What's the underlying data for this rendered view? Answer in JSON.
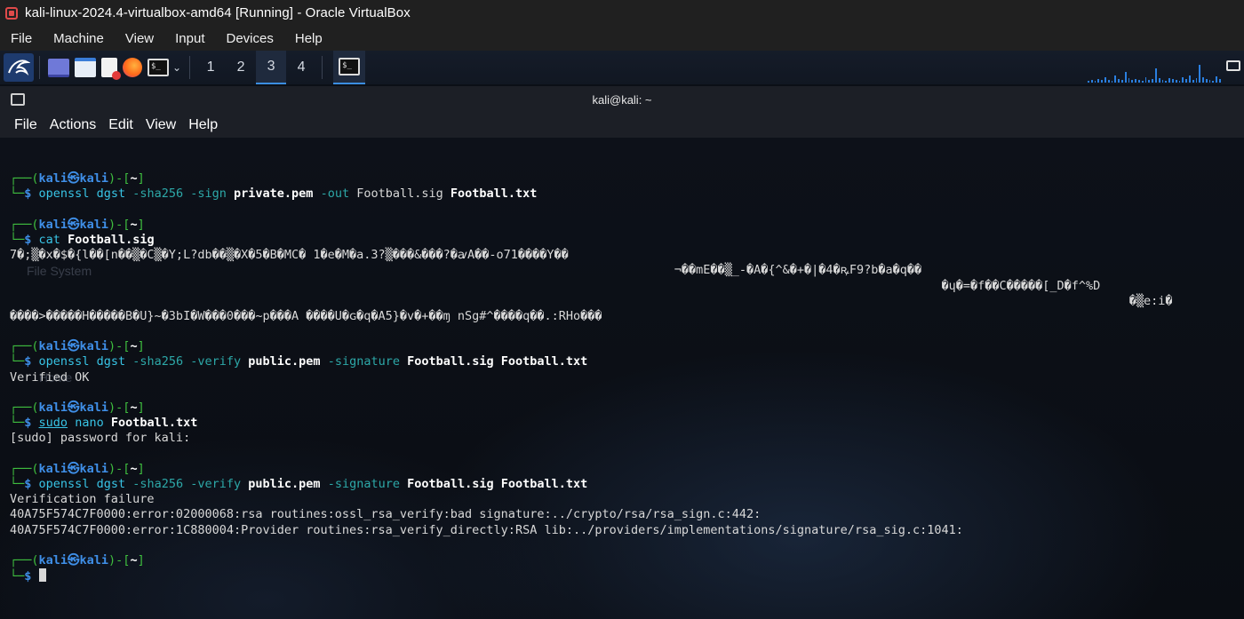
{
  "vbox": {
    "title": "kali-linux-2024.4-virtualbox-amd64 [Running] - Oracle VirtualBox",
    "menu": [
      "File",
      "Machine",
      "View",
      "Input",
      "Devices",
      "Help"
    ]
  },
  "panel": {
    "workspaces": [
      "1",
      "2",
      "3",
      "4"
    ],
    "active_workspace": "3",
    "terminal_icon_glyph": "$_"
  },
  "terminal": {
    "title": "kali@kali: ~",
    "menu": [
      "File",
      "Actions",
      "Edit",
      "View",
      "Help"
    ],
    "prompt": {
      "line1_prefix": "┌──(",
      "user": "kali",
      "at": "㉿",
      "host": "kali",
      "mid": ")-[",
      "dir": "~",
      "end": "]",
      "line2_prefix": "└─",
      "dollar": "$"
    },
    "sessions": [
      {
        "cmd": "openssl",
        "parts": [
          {
            "t": " dgst ",
            "c": "plain-cmd"
          },
          {
            "t": "-sha256 -sign ",
            "c": "opt"
          },
          {
            "t": "private.pem",
            "c": "w"
          },
          {
            "t": " -out ",
            "c": "opt"
          },
          {
            "t": "Football.sig ",
            "c": "plain"
          },
          {
            "t": "Football.txt",
            "c": "w"
          }
        ],
        "output": []
      },
      {
        "cmd": "cat",
        "parts": [
          {
            "t": " ",
            "c": "plain"
          },
          {
            "t": "Football.sig",
            "c": "w"
          }
        ],
        "output": [
          "7�;▒�x�$�{l��[n��▒�C▒�Y;L?db��▒�X�5�B�MC� 1�e�M�a.3?▒���&���?�ꜹA��-o71����Y��",
          "                                                                                            ¬��mE��▒_-�A�{^&�+�|�4�ꝶF9?b�a�q��",
          "                                                                                                                                 �ɥ�=�f��C�����[_D�f^%D",
          "                                                                                                                                                           �▒e:i�",
          "����>�����H�����B�U}~�3bI�W���0���~p���A ����U�ɢ�q�A5}�v�+��ɱ nSg#^����q��.:RHo���"
        ]
      },
      {
        "cmd": "openssl",
        "parts": [
          {
            "t": " dgst ",
            "c": "plain-cmd"
          },
          {
            "t": "-sha256 -verify ",
            "c": "opt"
          },
          {
            "t": "public.pem",
            "c": "w"
          },
          {
            "t": " -signature ",
            "c": "opt"
          },
          {
            "t": "Football.sig ",
            "c": "w"
          },
          {
            "t": "Football.txt",
            "c": "w"
          }
        ],
        "output": [
          "Verified OK"
        ]
      },
      {
        "cmd": "sudo",
        "cmd_underline": true,
        "parts": [
          {
            "t": " nano ",
            "c": "plain-cmd"
          },
          {
            "t": "Football.txt",
            "c": "w"
          }
        ],
        "output": [
          "[sudo] password for kali:"
        ]
      },
      {
        "cmd": "openssl",
        "parts": [
          {
            "t": " dgst ",
            "c": "plain-cmd"
          },
          {
            "t": "-sha256 -verify ",
            "c": "opt"
          },
          {
            "t": "public.pem",
            "c": "w"
          },
          {
            "t": " -signature ",
            "c": "opt"
          },
          {
            "t": "Football.sig ",
            "c": "w"
          },
          {
            "t": "Football.txt",
            "c": "w"
          }
        ],
        "output": [
          "Verification failure",
          "40A75F574C7F0000:error:02000068:rsa routines:ossl_rsa_verify:bad signature:../crypto/rsa/rsa_sign.c:442:",
          "40A75F574C7F0000:error:1C880004:Provider routines:rsa_verify_directly:RSA lib:../providers/implementations/signature/rsa_sig.c:1041:"
        ]
      }
    ]
  },
  "desktop_ghost": {
    "file_system": "File System",
    "home": "Home"
  },
  "colors": {
    "prompt_green": "#3fbf3f",
    "prompt_blue": "#3f8fe8",
    "command_cyan": "#38c4e6",
    "option_teal": "#2da8a8",
    "accent_blue": "#3b8de0"
  }
}
